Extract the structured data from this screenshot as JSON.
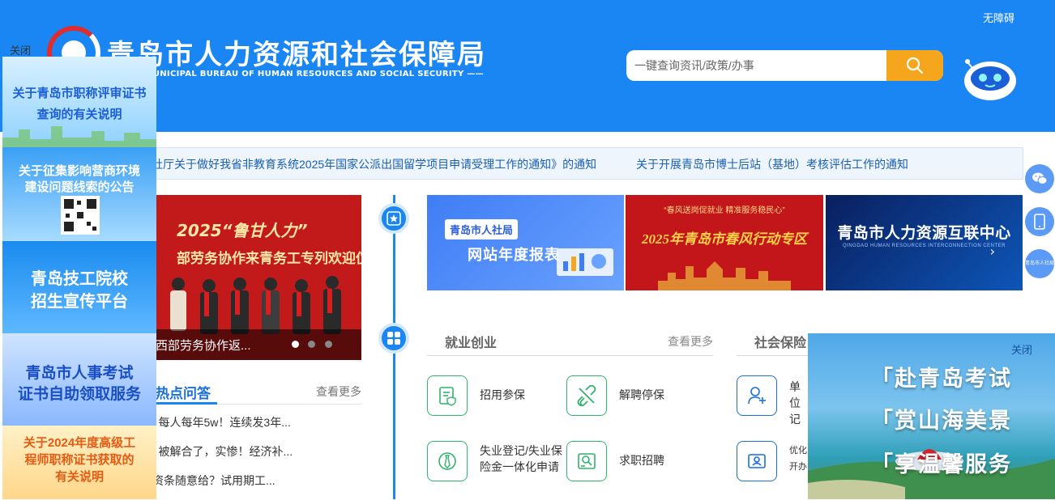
{
  "header": {
    "accessibility_link": "无障碍",
    "title": "青岛市人力资源和社会保障局",
    "subtitle": "O MUNICIPAL BUREAU OF HUMAN RESOURCES AND SOCIAL SECURITY ——",
    "search": {
      "placeholder": "一键查询资讯/政策/办事",
      "button_icon": "search-icon"
    },
    "assistant_icon": "robot-icon",
    "brand_color": "#1a86f4",
    "accent_color": "#f5a61d"
  },
  "ticker": {
    "items": [
      "省人社厅关于做好我省非教育系统2025年国家公派出国留学项目申请受理工作的通知》的通知",
      "关于开展青岛市博士后站（基地）考核评估工作的通知"
    ]
  },
  "slider": {
    "sign_line1": "2025“鲁甘人力”",
    "sign_line2": "部劳务协作来青务工专列欢迎仪式",
    "caption": "西部劳务协作返...",
    "dots": 3,
    "active_dot": 1
  },
  "hot_qa": {
    "title": "热点问答",
    "more": "查看更多",
    "items": [
      "| 每人每年5w！连续发3年...",
      "| 被解合了，实惨！经济补...",
      "资条随意给？试用期工..."
    ]
  },
  "banners": {
    "b1_tag": "青岛市人社局",
    "b1_text": "网站年度报表",
    "b2_top": "“春风送岗促就业 精准服务稳民心”",
    "b2_main": "2025年青岛市春风行动专区",
    "b3_main": "青岛市人力资源互联中心",
    "b3_sub": "QINGDAO HUMAN RESOURCES INTERCONNECTION CENTER"
  },
  "services": {
    "section1_title": "就业创业",
    "section1_more": "查看更多",
    "section2_title": "社会保险",
    "items": [
      {
        "label": "招用参保",
        "icon": "document-shield-icon"
      },
      {
        "label": "解聘停保",
        "icon": "broken-link-icon"
      },
      {
        "label": "单位\n记",
        "icon": "add-user-icon"
      },
      {
        "label": "失业登记/失业保险金一体化申请",
        "icon": "badge-tie-icon"
      },
      {
        "label": "求职招聘",
        "icon": "person-search-icon"
      },
      {
        "label": "优化\n开办",
        "icon": "id-card-icon"
      }
    ]
  },
  "left_float": {
    "close": "关闭",
    "cards": [
      {
        "line1": "关于青岛市职称评审证书",
        "line2": "查询的有关说明"
      },
      {
        "line1": "关于征集影响营商环境",
        "line2": "建设问题线索的公告"
      },
      {
        "line1": "青岛技工院校",
        "line2": "招生宣传平台"
      },
      {
        "line1": "青岛市人事考试",
        "line2": "证书自助领取服务"
      },
      {
        "line1": "关于2024年度高级工",
        "line2": "程师职称证书获取的",
        "line3": "有关说明"
      }
    ]
  },
  "side_icons": {
    "wechat": "wechat-icon",
    "mobile": "mobile-icon",
    "small_text": "青岛市人社局"
  },
  "right_float": {
    "close": "关闭",
    "line1": "「赴青岛考试",
    "line2": "「赏山海美景",
    "line3": "「享温馨服务"
  }
}
